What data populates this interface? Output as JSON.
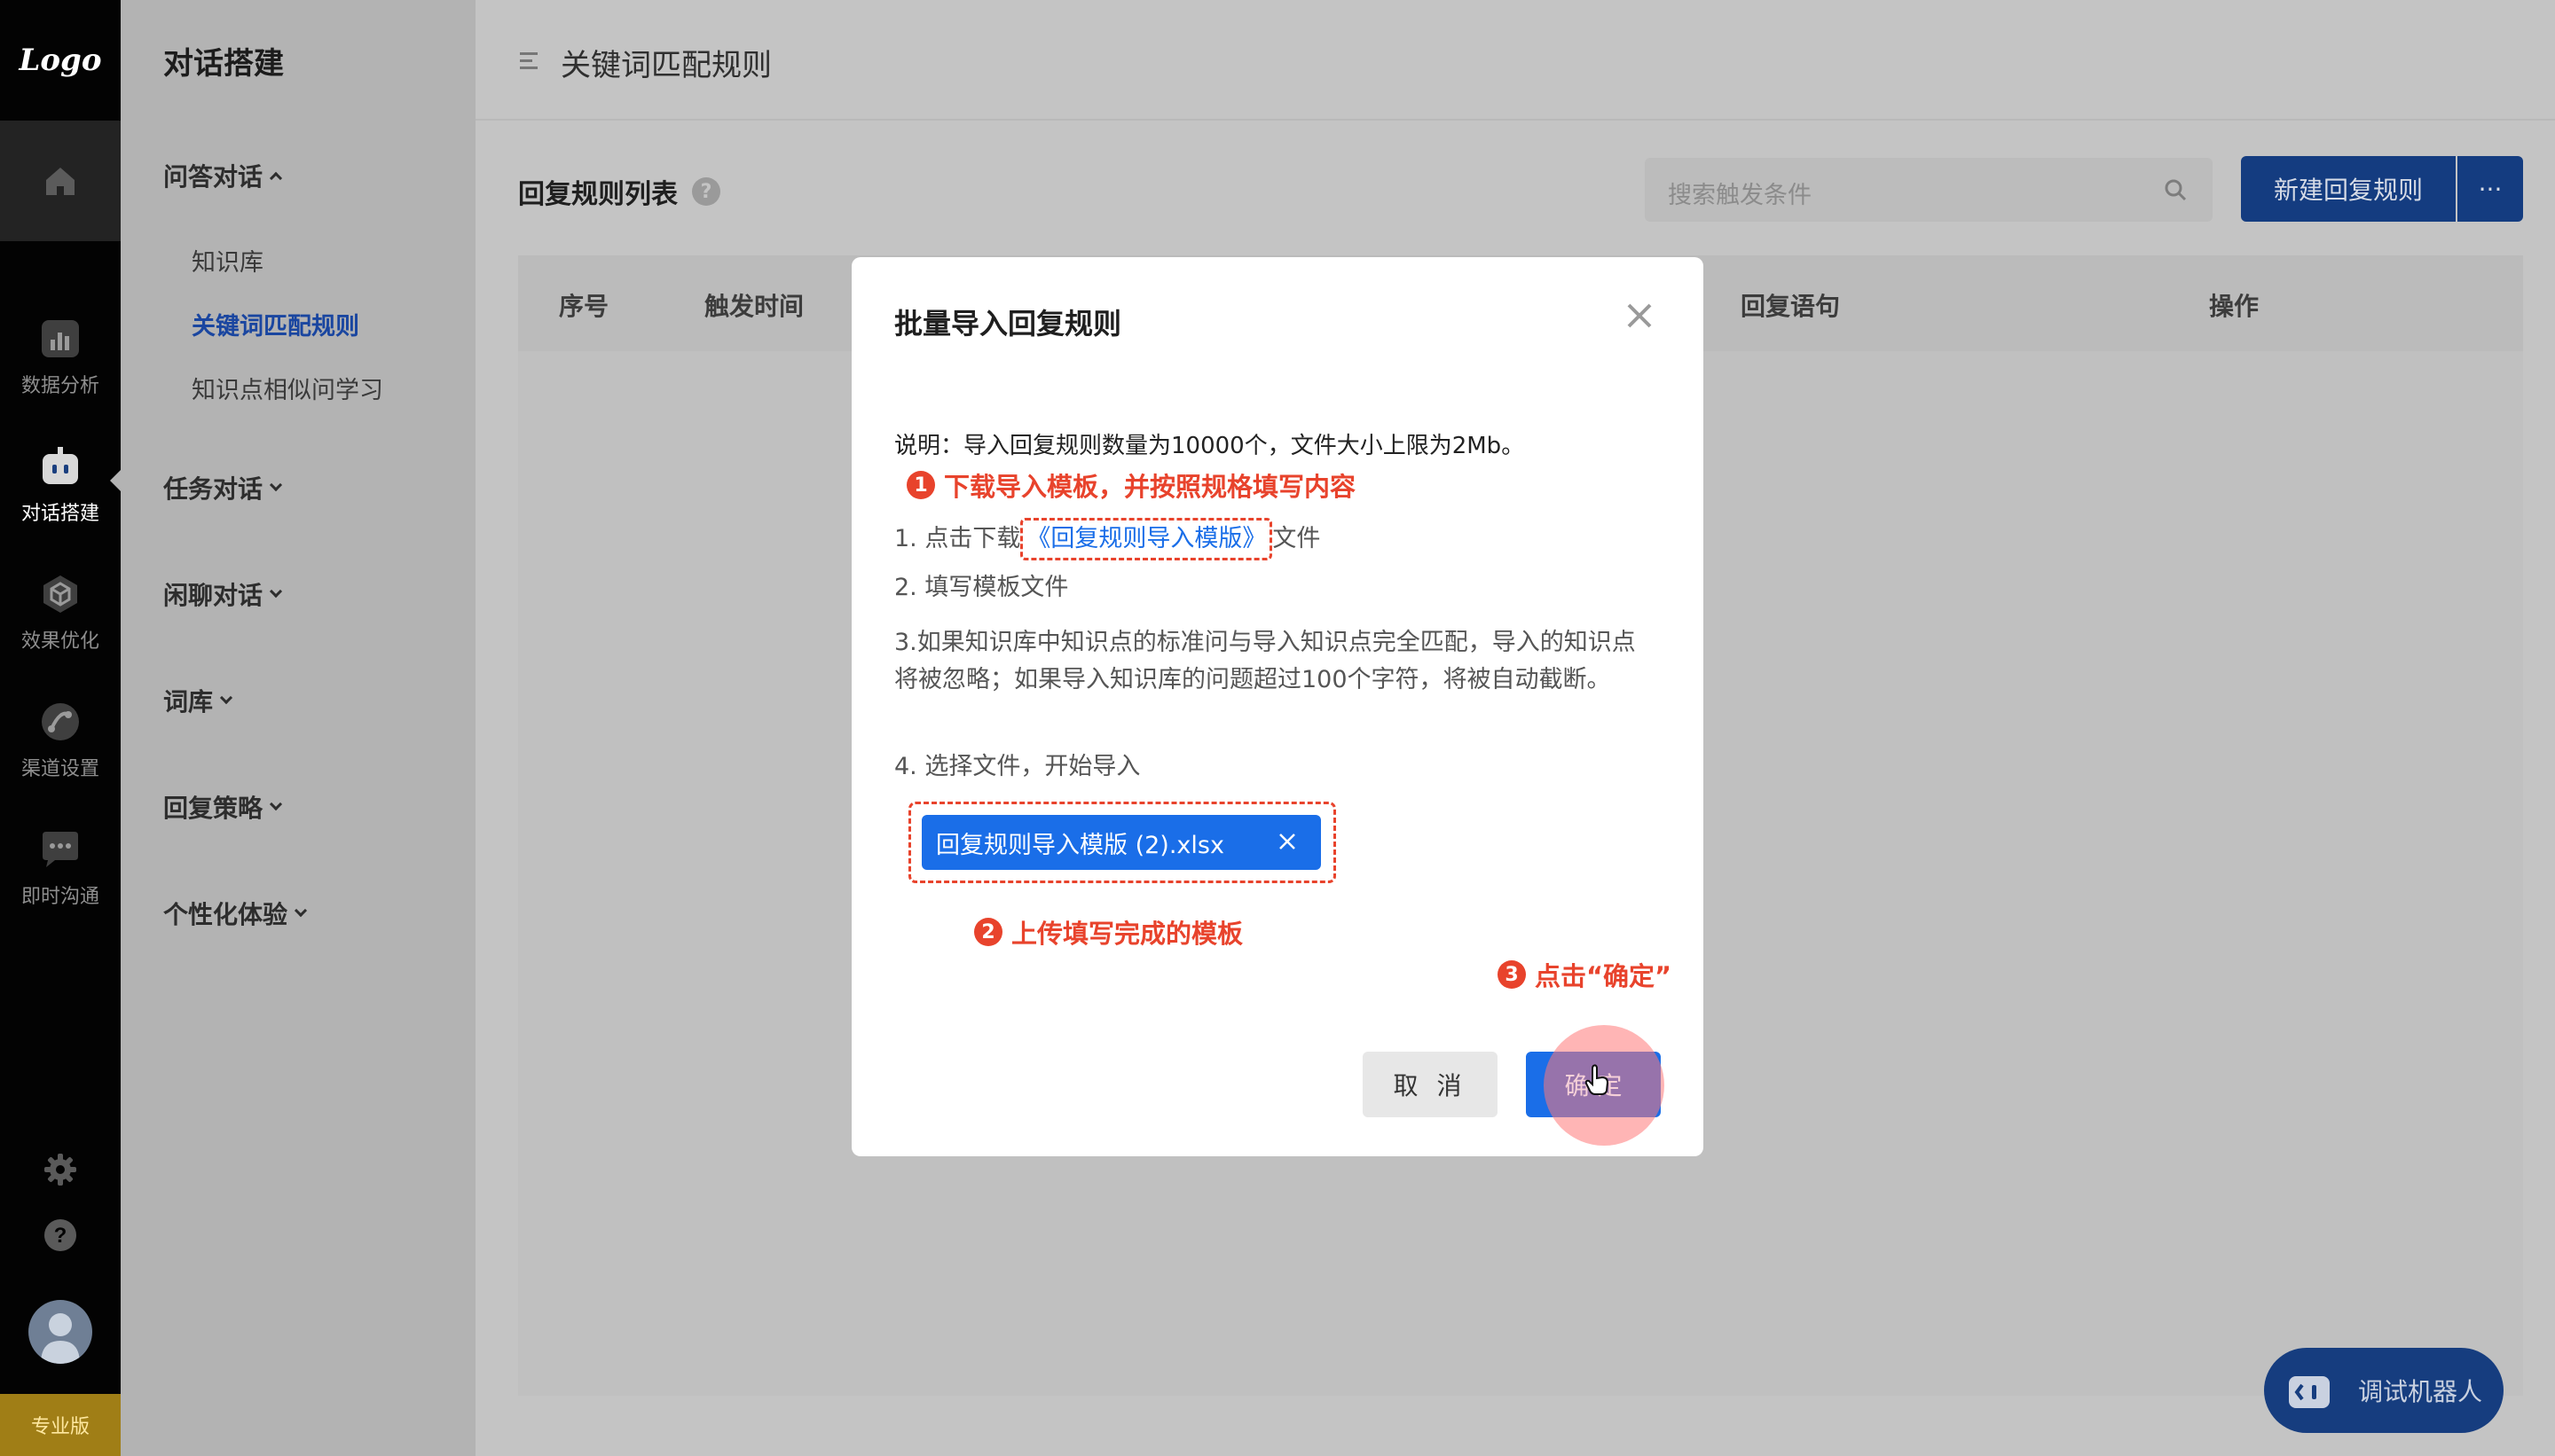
{
  "rail": {
    "logo": "Logo",
    "items": [
      {
        "label": "数据分析",
        "icon": "bar-chart-icon"
      },
      {
        "label": "对话搭建",
        "icon": "robot-icon"
      },
      {
        "label": "效果优化",
        "icon": "cube-icon"
      },
      {
        "label": "渠道设置",
        "icon": "channel-icon"
      },
      {
        "label": "即时沟通",
        "icon": "chat-icon"
      }
    ],
    "edition": "专业版"
  },
  "sidebar": {
    "title": "对话搭建",
    "groups": [
      {
        "label": "问答对话"
      },
      {
        "label": "任务对话"
      },
      {
        "label": "闲聊对话"
      },
      {
        "label": "词库"
      },
      {
        "label": "回复策略"
      },
      {
        "label": "个性化体验"
      }
    ],
    "subitems": [
      "知识库",
      "关键词匹配规则",
      "知识点相似问学习"
    ]
  },
  "header": {
    "breadcrumb": "关键词匹配规则"
  },
  "main": {
    "list_title": "回复规则列表",
    "help": "?",
    "search_placeholder": "搜索触发条件",
    "new_button": "新建回复规则",
    "more_button": "···",
    "columns": [
      "序号",
      "触发时间",
      "回复语句",
      "操作"
    ],
    "bot_button": "调试机器人"
  },
  "modal": {
    "title": "批量导入回复规则",
    "description": "说明：导入回复规则数量为10000个，文件大小上限为2Mb。",
    "step1_prefix": "1. 点击下载",
    "step1_link": "《回复规则导入模版》",
    "step1_suffix": "文件",
    "step2": "2. 填写模板文件",
    "step3": "3.如果知识库中知识点的标准问与导入知识点完全匹配，导入的知识点将被忽略；如果导入知识库的问题超过100个字符，将被自动截断。",
    "step4": "4. 选择文件，开始导入",
    "file_name": "回复规则导入模版 (2).xlsx",
    "cancel": "取 消",
    "ok": "确 定"
  },
  "annotations": {
    "n1": "1",
    "note1": "下载导入模板，并按照规格填写内容",
    "n2": "2",
    "note2": "上传填写完成的模板",
    "n3": "3",
    "note3": "点击“确定”"
  },
  "colors": {
    "primary": "#1a6ee8",
    "annotation_red": "#e8432c",
    "edition_gold": "#a07e16"
  }
}
